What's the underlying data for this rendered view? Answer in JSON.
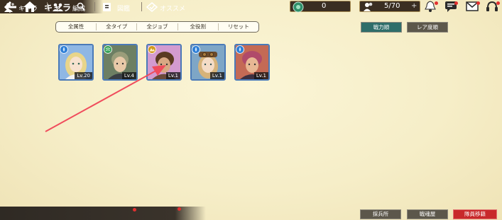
{
  "header": {
    "title": "キャラ",
    "currency_value": "0",
    "roster_count": "5/70",
    "plus_symbol": "+"
  },
  "filters": [
    "全属性",
    "全タイプ",
    "全ジョブ",
    "全役割",
    "リセット"
  ],
  "sort": {
    "active": "戦力順",
    "inactive": "レア度順"
  },
  "characters": [
    {
      "level": "Lv.20",
      "element": "water",
      "hair": "#e8d58a",
      "bg": "#8fb7e4"
    },
    {
      "level": "Lv.4",
      "element": "wind",
      "hair": "#9a9d7a",
      "bg": "#6d7f63"
    },
    {
      "level": "Lv.1",
      "element": "earth",
      "hair": "#5a3a22",
      "bg": "#d39bd0"
    },
    {
      "level": "Lv.1",
      "element": "water",
      "hair": "#d6b37a",
      "bg": "#7ea6c6"
    },
    {
      "level": "Lv.1",
      "element": "water",
      "hair": "#b04a6a",
      "bg": "#c46a55"
    }
  ],
  "bottom_nav": [
    {
      "label": "キャラ",
      "icon": "character-icon"
    },
    {
      "label": "編成",
      "icon": "formation-icon"
    },
    {
      "label": "図鑑",
      "icon": "encyclopedia-icon"
    },
    {
      "label": "オススメ",
      "icon": "recommend-icon"
    }
  ],
  "bottom_right_buttons": [
    "採兵所",
    "戦魂屋",
    "隊員移籍"
  ],
  "colors": {
    "accent_teal": "#2f6e6a",
    "danger_red": "#c8292b",
    "card_border": "#4a7ab8",
    "arrow": "#f04c5c"
  }
}
